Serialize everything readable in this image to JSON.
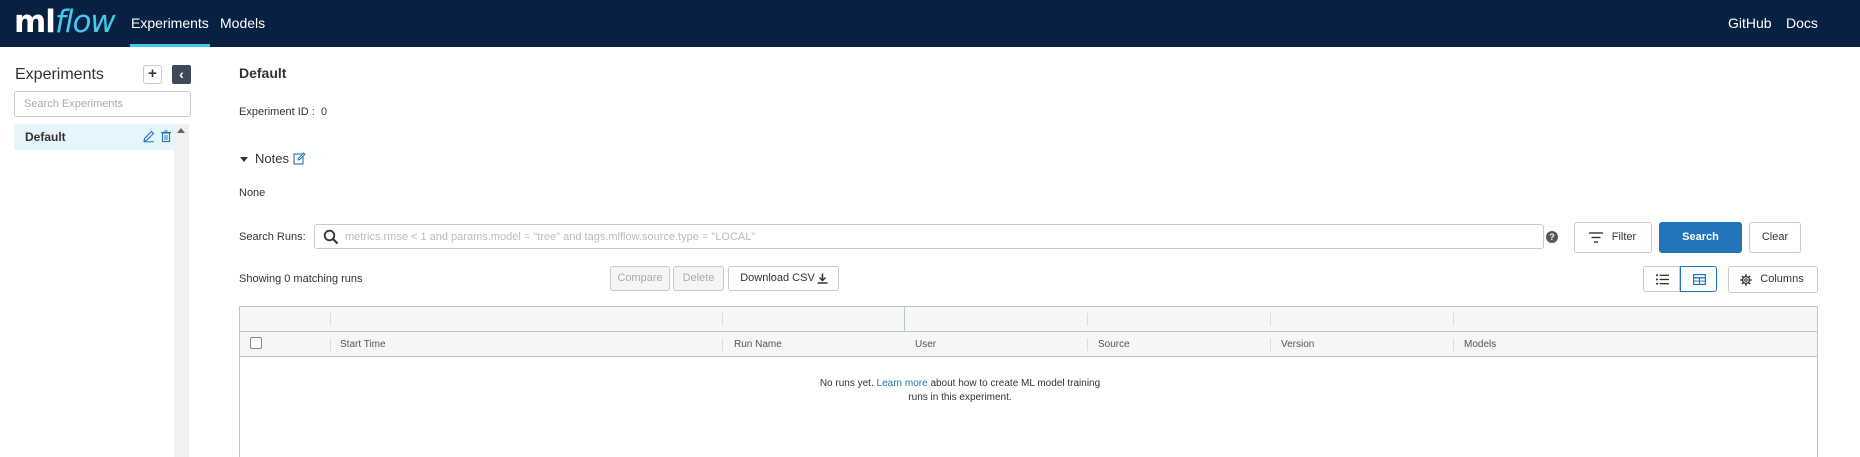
{
  "nav": {
    "logo_ml": "ml",
    "logo_flow": "flow",
    "experiments": "Experiments",
    "models": "Models",
    "github": "GitHub",
    "docs": "Docs",
    "accent": "#43c9ed",
    "background": "#082142"
  },
  "sidebar": {
    "title": "Experiments",
    "add_label": "+",
    "collapse_label": "‹",
    "search_placeholder": "Search Experiments",
    "items": [
      {
        "label": "Default",
        "selected": true
      }
    ]
  },
  "main": {
    "title": "Default",
    "experiment_id_label": "Experiment ID :",
    "experiment_id": "0",
    "notes_label": "Notes",
    "notes_value": "None",
    "search_runs_label": "Search Runs:",
    "search_placeholder": "metrics.rmse < 1 and params.model = \"tree\" and tags.mlflow.source.type = \"LOCAL\"",
    "help_label": "?",
    "filter_label": "Filter",
    "search_label": "Search",
    "clear_label": "Clear",
    "matching": "Showing 0 matching runs",
    "compare_label": "Compare",
    "delete_label": "Delete",
    "download_label": "Download CSV",
    "columns_label": "Columns",
    "primary_color": "#2374bb"
  },
  "table": {
    "headers": [
      "Start Time",
      "Run Name",
      "User",
      "Source",
      "Version",
      "Models"
    ],
    "empty_prefix": "No runs yet.",
    "empty_link": "Learn more",
    "empty_suffix_1": "about how to create ML model training",
    "empty_suffix_2": "runs in this experiment."
  }
}
